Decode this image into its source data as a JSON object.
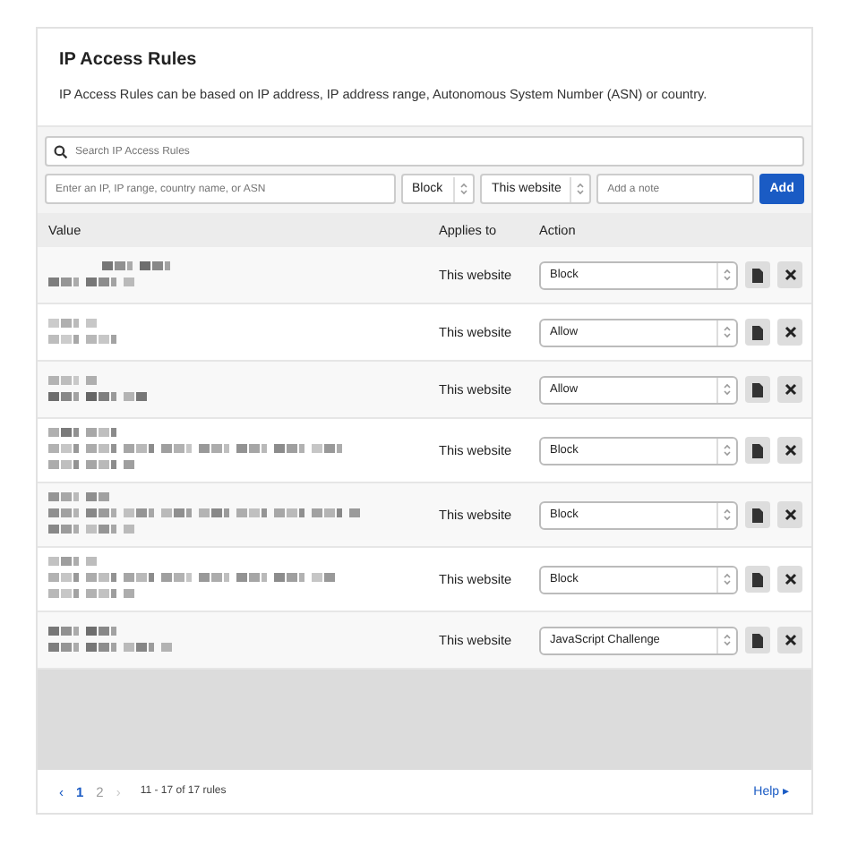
{
  "title": "IP Access Rules",
  "description": "IP Access Rules can be based on IP address, IP address range, Autonomous System Number (ASN) or country.",
  "search": {
    "placeholder": "Search IP Access Rules"
  },
  "form": {
    "value_placeholder": "Enter an IP, IP range, country name, or ASN",
    "action": "Block",
    "applies_to": "This website",
    "note_placeholder": "Add a note",
    "add_button": "Add"
  },
  "table": {
    "columns": [
      "Value",
      "Applies to",
      "Action"
    ],
    "rows": [
      {
        "applies_to": "This website",
        "action": "Block"
      },
      {
        "applies_to": "This website",
        "action": "Allow"
      },
      {
        "applies_to": "This website",
        "action": "Allow"
      },
      {
        "applies_to": "This website",
        "action": "Block"
      },
      {
        "applies_to": "This website",
        "action": "Block"
      },
      {
        "applies_to": "This website",
        "action": "Block"
      },
      {
        "applies_to": "This website",
        "action": "JavaScript Challenge"
      }
    ]
  },
  "pagination": {
    "prev": "‹",
    "pages": [
      {
        "label": "1",
        "selected": true
      },
      {
        "label": "2",
        "selected": false
      }
    ],
    "next": "›",
    "next_disabled": true,
    "summary": "11 - 17 of 17 rules"
  },
  "help": "Help ▸"
}
